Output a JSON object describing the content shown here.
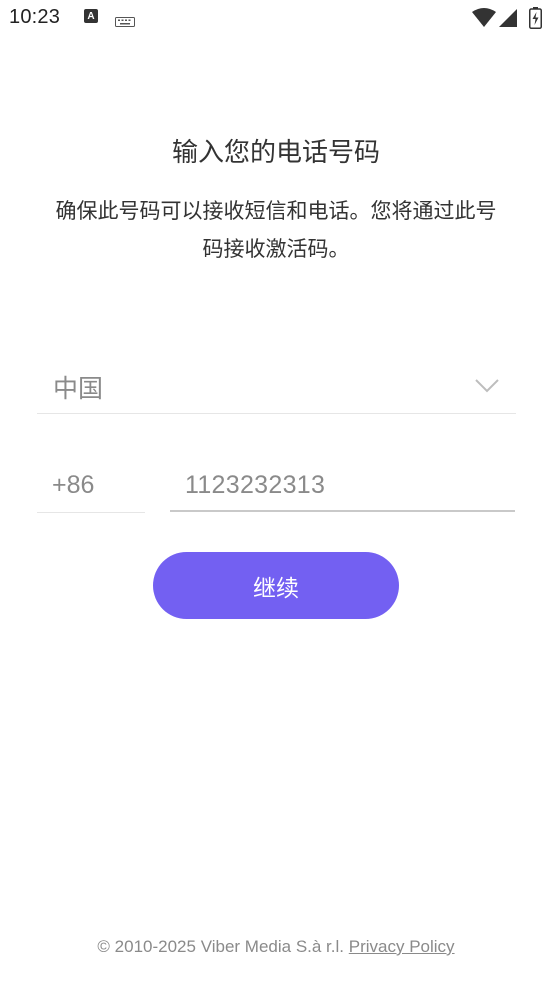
{
  "status_bar": {
    "time": "10:23",
    "icons": [
      "text-notification-icon",
      "keyboard-icon",
      "wifi-icon",
      "cell-signal-icon",
      "battery-icon"
    ]
  },
  "header": {
    "title": "输入您的电话号码",
    "subtitle": "确保此号码可以接收短信和电话。您将通过此号码接收激活码。"
  },
  "form": {
    "country": "中国",
    "country_code": "+86",
    "phone_number": "1123232313"
  },
  "actions": {
    "continue_label": "继续"
  },
  "footer": {
    "copyright": "© 2010-2025 Viber Media S.à r.l.",
    "privacy_label": "Privacy Policy"
  },
  "colors": {
    "accent": "#7360f2",
    "muted_text": "#8a8a8a"
  }
}
